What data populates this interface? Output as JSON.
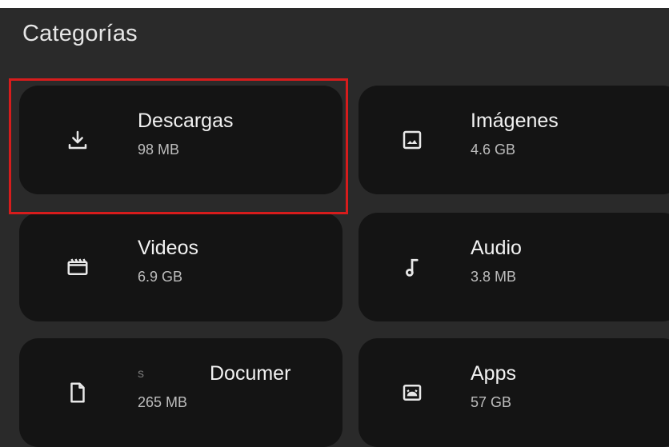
{
  "header": {
    "title": "Categorías"
  },
  "categories": [
    {
      "label": "Descargas",
      "size": "98 MB",
      "icon": "download-icon"
    },
    {
      "label": "Imágenes",
      "size": "4.6 GB",
      "icon": "image-icon"
    },
    {
      "label": "Videos",
      "size": "6.9 GB",
      "icon": "video-icon"
    },
    {
      "label": "Audio",
      "size": "3.8 MB",
      "icon": "music-note-icon"
    },
    {
      "label_prefix": "s",
      "label": "Documer",
      "size": "265 MB",
      "icon": "document-icon"
    },
    {
      "label": "Apps",
      "size": "57 GB",
      "icon": "android-icon"
    }
  ],
  "colors": {
    "background": "#2a2a2a",
    "card": "#141414",
    "highlight": "#d71c1c"
  }
}
